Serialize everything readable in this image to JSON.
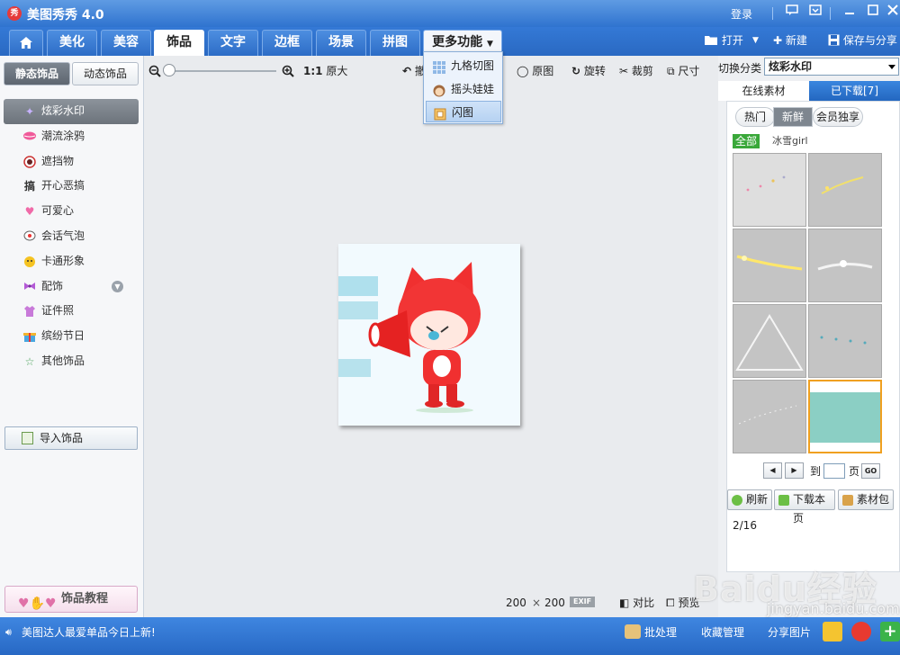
{
  "titlebar": {
    "app_icon": "秀",
    "title": "美图秀秀 4.0",
    "login": "登录"
  },
  "tabs": [
    {
      "label": "美化"
    },
    {
      "label": "美容"
    },
    {
      "label": "饰品"
    },
    {
      "label": "文字"
    },
    {
      "label": "边框"
    },
    {
      "label": "场景"
    },
    {
      "label": "拼图"
    },
    {
      "label": "更多功能"
    }
  ],
  "toolbar_right": {
    "open": "打开",
    "new": "新建",
    "save_share": "保存与分享"
  },
  "left": {
    "subtabs": {
      "static": "静态饰品",
      "dynamic": "动态饰品"
    },
    "categories": [
      {
        "label": "炫彩水印",
        "icon": "sparkle-icon"
      },
      {
        "label": "潮流涂鸦",
        "icon": "lips-icon"
      },
      {
        "label": "遮挡物",
        "icon": "mask-icon"
      },
      {
        "label": "开心恶搞",
        "icon": "gao-icon"
      },
      {
        "label": "可爱心",
        "icon": "heart-icon"
      },
      {
        "label": "会话气泡",
        "icon": "bubble-icon"
      },
      {
        "label": "卡通形象",
        "icon": "cartoon-icon"
      },
      {
        "label": "配饰",
        "icon": "bow-icon"
      },
      {
        "label": "证件照",
        "icon": "shirt-icon"
      },
      {
        "label": "缤纷节日",
        "icon": "gift-icon"
      },
      {
        "label": "其他饰品",
        "icon": "star-icon"
      }
    ],
    "import_label": "导入饰品",
    "tutorial_label": "饰品教程",
    "gao_glyph": "搞"
  },
  "center": {
    "ratio_label": "1:1",
    "original_size": "原大",
    "tool_cut": "撤",
    "tool_original": "原图",
    "tool_rotate": "旋转",
    "tool_crop": "裁剪",
    "tool_size": "尺寸",
    "dims_w": "200",
    "dims_x": "×",
    "dims_h": "200",
    "exif": "EXIF",
    "compare": "对比",
    "preview": "预览"
  },
  "dropdown": [
    {
      "label": "九格切图"
    },
    {
      "label": "摇头娃娃"
    },
    {
      "label": "闪图"
    }
  ],
  "right": {
    "switch_label": "切换分类",
    "switch_value": "炫彩水印",
    "tab_online": "在线素材",
    "tab_downloaded": "已下载[7]",
    "filters": {
      "hot": "热门",
      "fresh": "新鲜",
      "member": "会员独享"
    },
    "all": "全部",
    "author": "冰雪girl",
    "page_status": "2/16",
    "goto_label": "到",
    "page_unit": "页",
    "go_label": "GO",
    "btn_refresh": "刷新",
    "btn_download_page": "下载本页",
    "btn_pack": "素材包"
  },
  "bottombar": {
    "news": "美图达人最爱单品今日上新!",
    "batch": "批处理",
    "manage": "收藏管理",
    "share": "分享图片"
  },
  "watermark": {
    "main": "Baidu经验",
    "sub": "jingyan.baidu.com"
  },
  "colors": {
    "titlebar": "#2f73cf",
    "accent": "#3479d6",
    "selected_border": "#f0a020",
    "all_badge": "#3aa83a"
  }
}
